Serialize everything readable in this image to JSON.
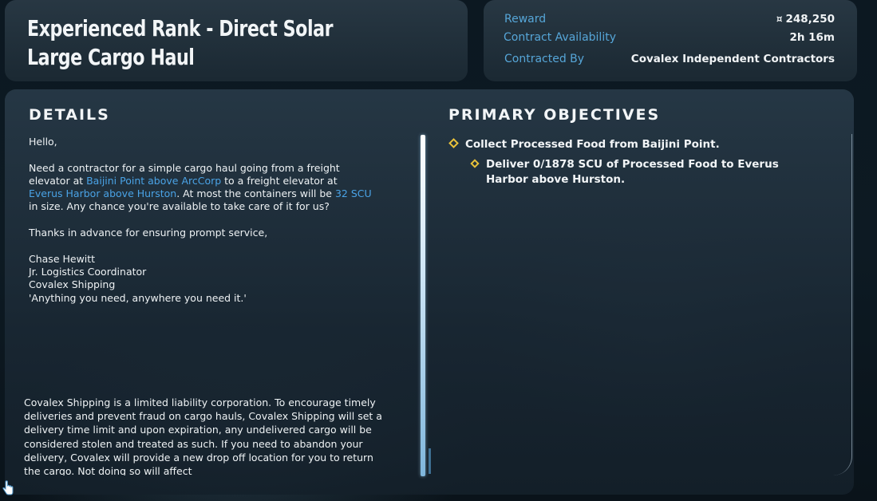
{
  "contract": {
    "title": "Experienced Rank - Direct Solar Large Cargo Haul"
  },
  "info": {
    "reward_label": "Reward",
    "reward_icon": "auec-currency-icon",
    "reward_value": "248,250",
    "availability_label": "Contract Availability",
    "availability_value": "2h 16m",
    "contracted_by_label": "Contracted By",
    "contracted_by_value": "Covalex Independent Contractors"
  },
  "details": {
    "heading": "DETAILS",
    "greeting": "Hello,",
    "p1_a": "Need a contractor for a simple cargo haul going from a freight elevator at ",
    "p1_loc1": "Baijini Point above ArcCorp",
    "p1_b": " to a freight elevator at ",
    "p1_loc2": "Everus Harbor above Hurston",
    "p1_c": ". At most the containers will be ",
    "p1_size": "32 SCU",
    "p1_d": " in size. Any chance you're available to take care of it for us?",
    "thanks": "Thanks in advance for ensuring prompt service,",
    "sig_name": "Chase Hewitt",
    "sig_role": "Jr. Logistics Coordinator",
    "sig_company": "Covalex Shipping",
    "sig_motto": "'Anything you need, anywhere you need it.'",
    "disclaimer": "Covalex Shipping is a limited liability corporation. To encourage timely deliveries and prevent fraud on cargo hauls, Covalex Shipping will set a delivery time limit and upon expiration, any undelivered cargo will be considered stolen and treated as such. If you need to abandon your delivery, Covalex will provide a new drop off location for you to return the cargo. Not doing so will affect"
  },
  "objectives": {
    "heading": "PRIMARY OBJECTIVES",
    "items": [
      "Collect Processed Food from Baijini Point.",
      "Deliver 0/1878 SCU of Processed Food to Everus Harbor above Hurston."
    ]
  },
  "colors": {
    "accent_blue": "#4aa3e6",
    "label_blue": "#56a6d8",
    "objective_marker": "#e9c23a"
  }
}
